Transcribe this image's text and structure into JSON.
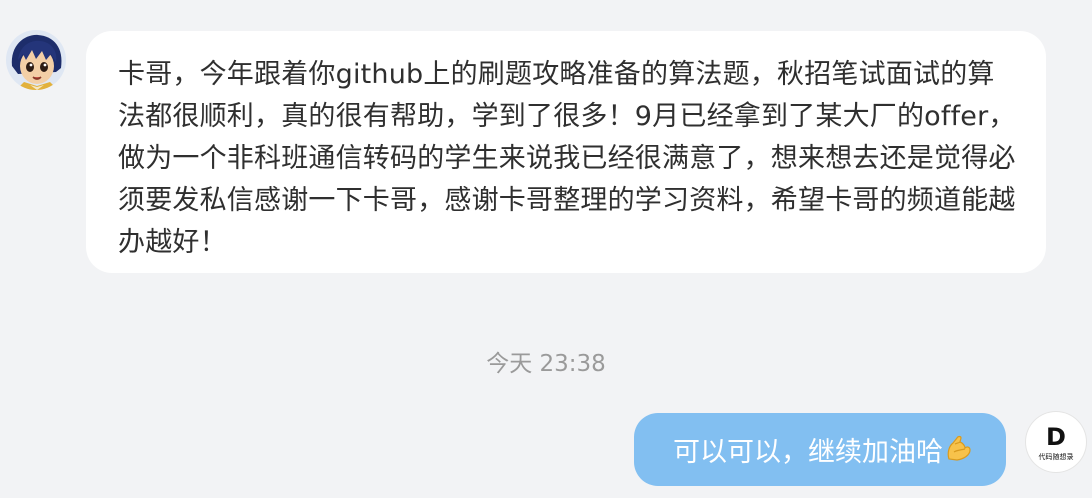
{
  "messages": {
    "incoming": {
      "avatar_icon": "user-avatar-anime-boy",
      "text": "卡哥，今年跟着你github上的刷题攻略准备的算法题，秋招笔试面试的算法都很顺利，真的很有帮助，学到了很多！9月已经拿到了某大厂的offer，做为一个非科班通信转码的学生来说我已经很满意了，想来想去还是觉得必须要发私信感谢一下卡哥，感谢卡哥整理的学习资料，希望卡哥的频道能越办越好！"
    },
    "timestamp": "今天 23:38",
    "outgoing": {
      "text": "可以可以，继续加油哈",
      "emoji_icon": "flexed-biceps-icon",
      "avatar": {
        "letter": "D",
        "name": "代码随想录"
      }
    }
  },
  "colors": {
    "background": "#f2f3f5",
    "incoming_bubble": "#ffffff",
    "outgoing_bubble": "#82bff1",
    "timestamp": "#9a9a9a"
  }
}
